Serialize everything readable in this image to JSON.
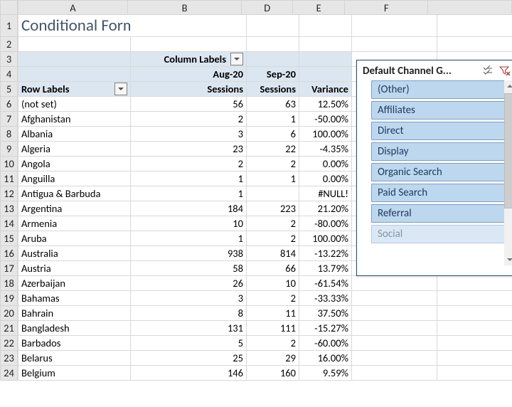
{
  "columns": [
    "A",
    "B",
    "D",
    "E",
    "F"
  ],
  "row_numbers": [
    1,
    2,
    3,
    4,
    5,
    6,
    7,
    8,
    9,
    10,
    11,
    12,
    13,
    14,
    15,
    16,
    17,
    18,
    19,
    20,
    21,
    22,
    23,
    24
  ],
  "title": "Conditional Formatting",
  "pivot": {
    "column_labels_caption": "Column Labels",
    "row_labels_caption": "Row Labels",
    "periods": {
      "p1": "Aug-20",
      "p2": "Sep-20"
    },
    "headers": {
      "s1": "Sessions",
      "s2": "Sessions",
      "var": "Variance"
    },
    "rows": [
      {
        "label": "(not set)",
        "s1": "56",
        "s2": "63",
        "var": "12.50%"
      },
      {
        "label": "Afghanistan",
        "s1": "2",
        "s2": "1",
        "var": "-50.00%"
      },
      {
        "label": "Albania",
        "s1": "3",
        "s2": "6",
        "var": "100.00%"
      },
      {
        "label": "Algeria",
        "s1": "23",
        "s2": "22",
        "var": "-4.35%"
      },
      {
        "label": "Angola",
        "s1": "2",
        "s2": "2",
        "var": "0.00%"
      },
      {
        "label": "Anguilla",
        "s1": "1",
        "s2": "1",
        "var": "0.00%"
      },
      {
        "label": "Antigua & Barbuda",
        "s1": "1",
        "s2": "",
        "var": "#NULL!"
      },
      {
        "label": "Argentina",
        "s1": "184",
        "s2": "223",
        "var": "21.20%"
      },
      {
        "label": "Armenia",
        "s1": "10",
        "s2": "2",
        "var": "-80.00%"
      },
      {
        "label": "Aruba",
        "s1": "1",
        "s2": "2",
        "var": "100.00%"
      },
      {
        "label": "Australia",
        "s1": "938",
        "s2": "814",
        "var": "-13.22%"
      },
      {
        "label": "Austria",
        "s1": "58",
        "s2": "66",
        "var": "13.79%"
      },
      {
        "label": "Azerbaijan",
        "s1": "26",
        "s2": "10",
        "var": "-61.54%"
      },
      {
        "label": "Bahamas",
        "s1": "3",
        "s2": "2",
        "var": "-33.33%"
      },
      {
        "label": "Bahrain",
        "s1": "8",
        "s2": "11",
        "var": "37.50%"
      },
      {
        "label": "Bangladesh",
        "s1": "131",
        "s2": "111",
        "var": "-15.27%"
      },
      {
        "label": "Barbados",
        "s1": "5",
        "s2": "2",
        "var": "-60.00%"
      },
      {
        "label": "Belarus",
        "s1": "25",
        "s2": "29",
        "var": "16.00%"
      },
      {
        "label": "Belgium",
        "s1": "146",
        "s2": "160",
        "var": "9.59%"
      }
    ]
  },
  "slicer": {
    "title": "Default Channel G...",
    "items": [
      "(Other)",
      "Affiliates",
      "Direct",
      "Display",
      "Organic Search",
      "Paid Search",
      "Referral",
      "Social"
    ]
  }
}
